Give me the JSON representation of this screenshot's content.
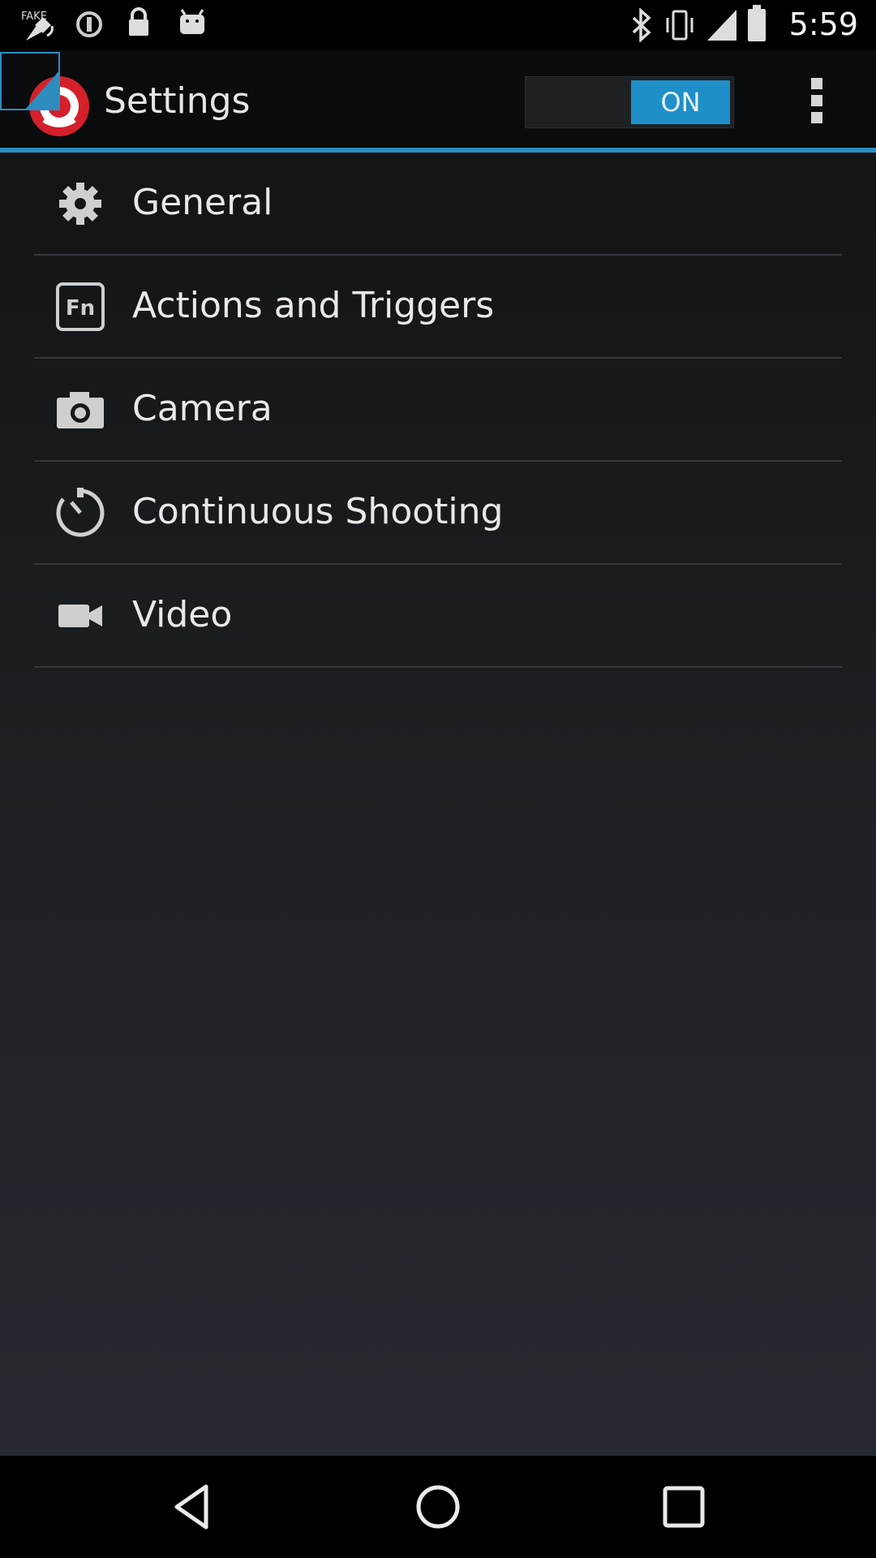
{
  "status_bar": {
    "time": "5:59",
    "icons": [
      "fake-gps-icon",
      "data-saver-icon",
      "lock-icon",
      "android-icon",
      "bluetooth-icon",
      "vibrate-icon",
      "signal-icon",
      "battery-icon"
    ]
  },
  "action_bar": {
    "title": "Settings",
    "toggle_label": "ON",
    "toggle_on": true,
    "accent_color": "#1e8fc9"
  },
  "menu": {
    "items": [
      {
        "label": "General",
        "icon": "gear-icon"
      },
      {
        "label": "Actions and Triggers",
        "icon": "fn-key-icon"
      },
      {
        "label": "Camera",
        "icon": "camera-icon"
      },
      {
        "label": "Continuous Shooting",
        "icon": "timer-icon"
      },
      {
        "label": "Video",
        "icon": "video-camera-icon"
      }
    ]
  },
  "nav_bar": {
    "buttons": [
      "back-icon",
      "home-icon",
      "recents-icon"
    ]
  }
}
